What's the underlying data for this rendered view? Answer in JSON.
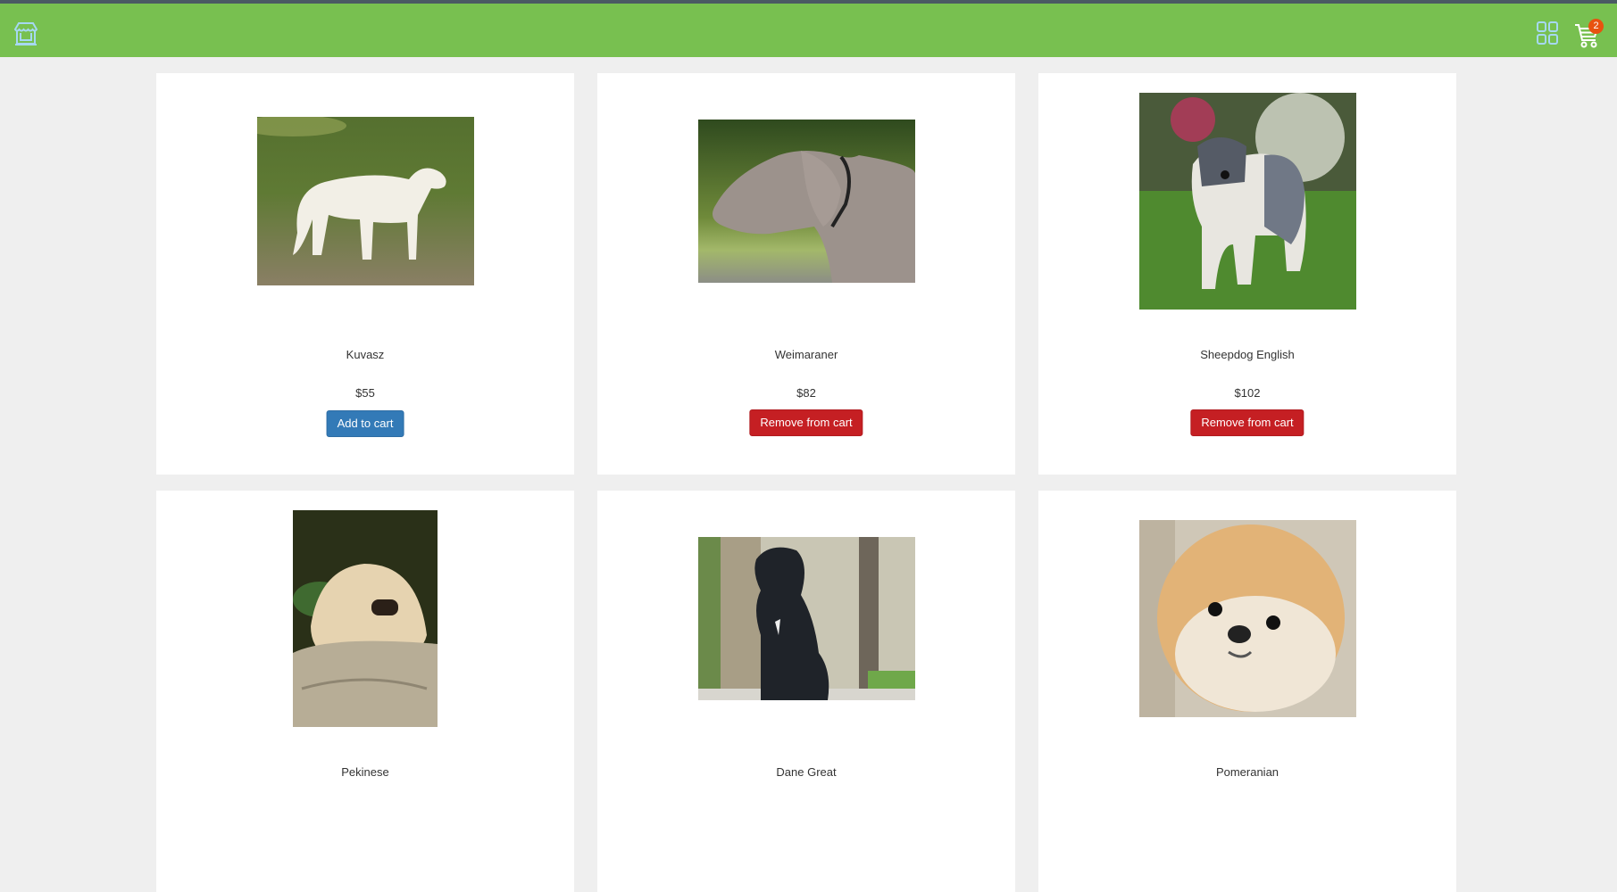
{
  "header": {
    "logo_icon": "storefront-icon",
    "grid_icon": "grid-view-icon",
    "cart_icon": "shopping-cart-icon",
    "cart_count": "2",
    "colors": {
      "header_bg": "#78c050",
      "badge": "#e8520f",
      "icon_stroke": "#a6d8f2"
    }
  },
  "products": [
    {
      "name": "Kuvasz",
      "price": "$55",
      "action": "Add to cart",
      "in_cart": false,
      "image": "white Kuvasz dog standing on grass"
    },
    {
      "name": "Weimaraner",
      "price": "$82",
      "action": "Remove from cart",
      "in_cart": true,
      "image": "grey Weimaraner head profile"
    },
    {
      "name": "Sheepdog English",
      "price": "$102",
      "action": "Remove from cart",
      "in_cart": true,
      "image": "Old English Sheepdog on lawn"
    },
    {
      "name": "Pekinese",
      "price": "",
      "action": "",
      "in_cart": null,
      "image": "Pekinese lying on a rock"
    },
    {
      "name": "Dane Great",
      "price": "",
      "action": "",
      "in_cart": null,
      "image": "black Great Dane puppy sitting"
    },
    {
      "name": "Pomeranian",
      "price": "",
      "action": "",
      "in_cart": null,
      "image": "Pomeranian face close-up"
    }
  ],
  "buttons": {
    "add_color": "#337ab7",
    "remove_color": "#c51f23"
  }
}
